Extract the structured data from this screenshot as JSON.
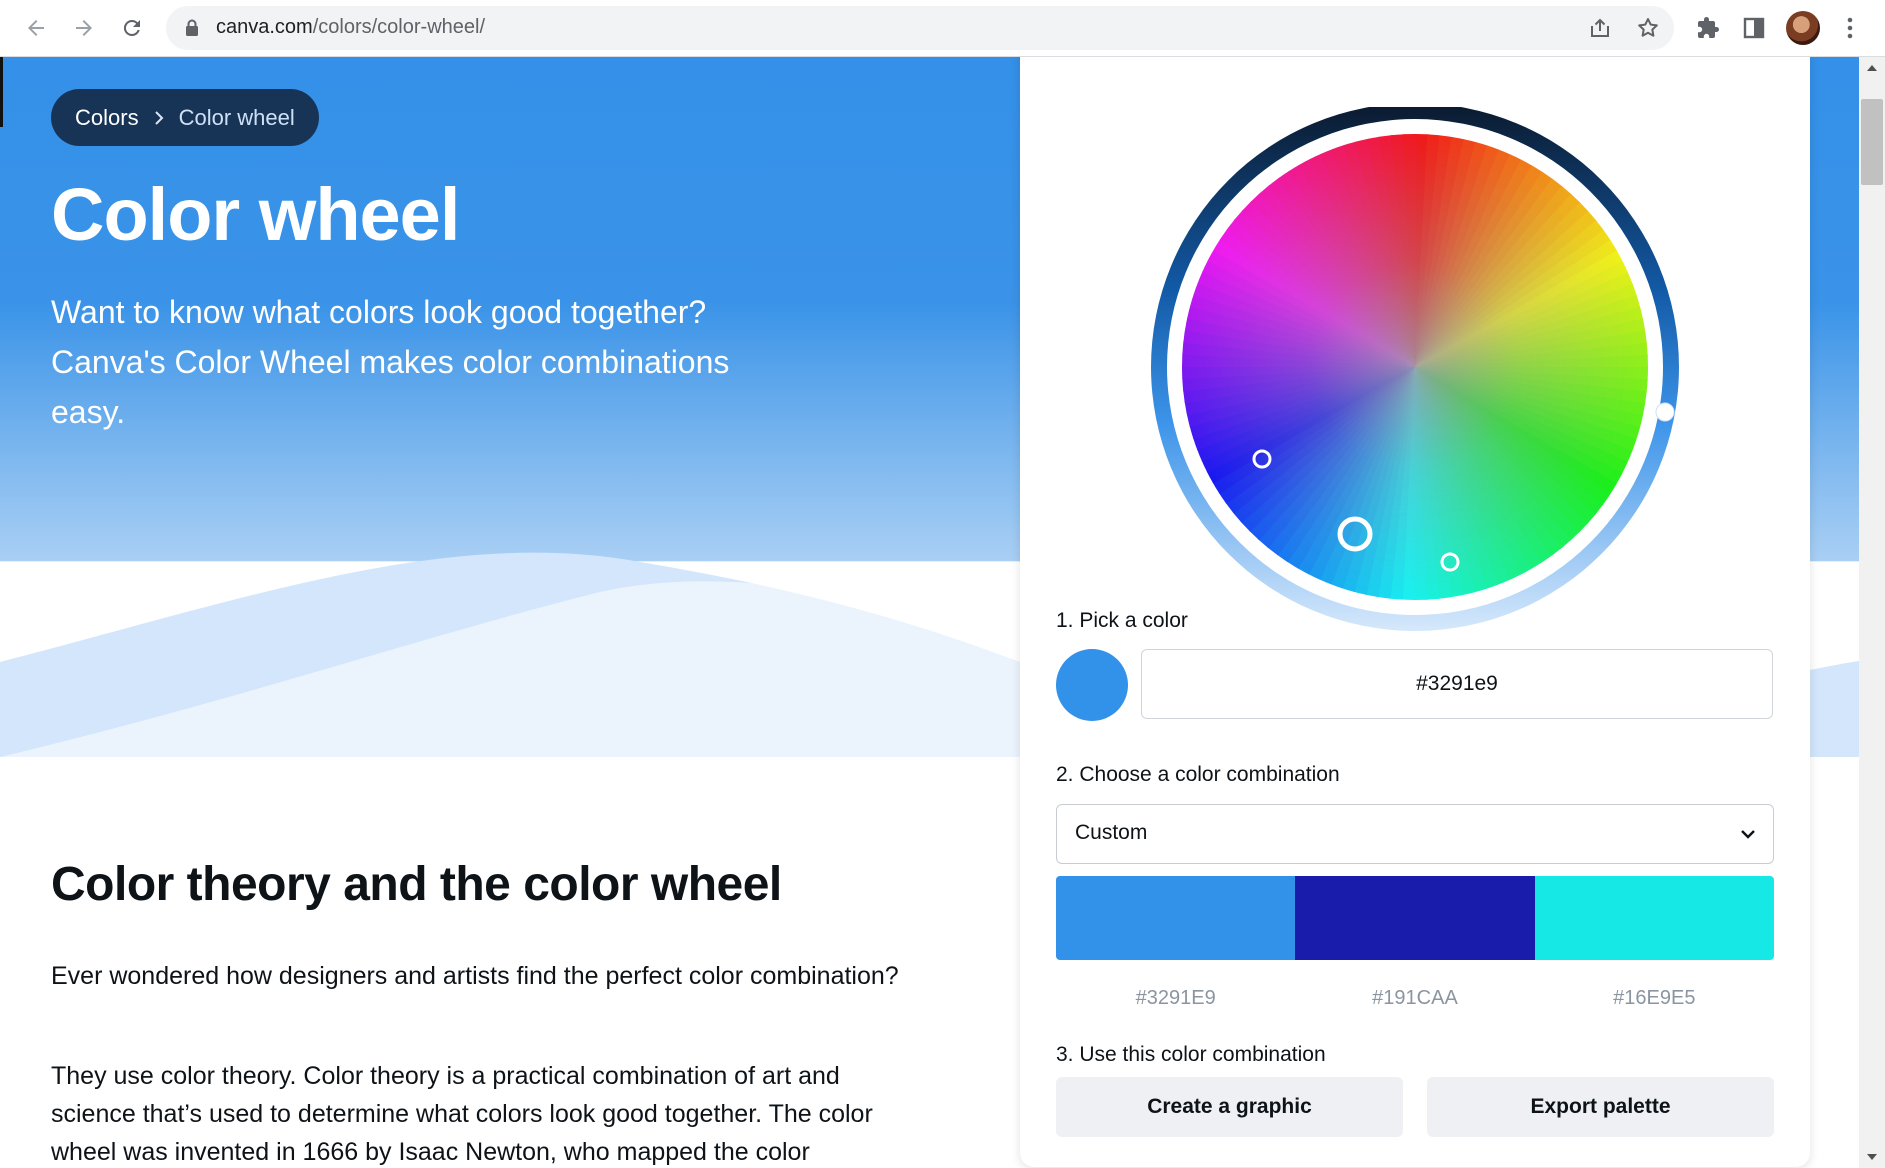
{
  "browser": {
    "url_host": "canva.com",
    "url_path": "/colors/color-wheel/",
    "icons": [
      "back-arrow-icon",
      "forward-arrow-icon",
      "reload-icon",
      "lock-icon",
      "share-icon",
      "star-icon",
      "extensions-puzzle-icon",
      "side-panel-icon",
      "menu-kebab-icon"
    ]
  },
  "page": {
    "breadcrumb": {
      "parent": "Colors",
      "current": "Color wheel"
    },
    "title": "Color wheel",
    "subtitle": "Want to know what colors look good together? Canva's Color Wheel makes color combinations easy.",
    "section_title": "Color theory and the color wheel",
    "para1": "Ever wondered how designers and artists find the perfect color combination?",
    "para2": "They use color theory. Color theory is a practical combination of art and science that’s used to determine what colors look good together. The color wheel was invented in 1666 by Isaac Newton, who mapped the color"
  },
  "tool": {
    "step1_label": "1. Pick a color",
    "picked_color": "#3291e9",
    "step2_label": "2. Choose a color combination",
    "combination": "Custom",
    "palette": [
      {
        "hex": "#3291E9",
        "color": "#3291e9"
      },
      {
        "hex": "#191CAA",
        "color": "#191caa"
      },
      {
        "hex": "#16E9E5",
        "color": "#16e9e5"
      }
    ],
    "step3_label": "3. Use this color combination",
    "create_button": "Create a graphic",
    "export_button": "Export palette"
  },
  "colors": {
    "hero_blue": "#3490e8",
    "breadcrumb_bg": "#173457",
    "button_bg": "#eef0f3"
  }
}
